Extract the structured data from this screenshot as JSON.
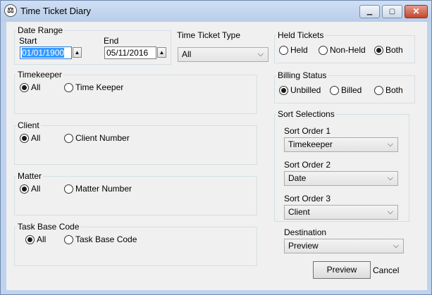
{
  "window": {
    "title": "Time Ticket Diary",
    "app_icon": "scales-icon",
    "min_icon": "minimize-icon",
    "max_icon": "maximize-icon",
    "close_icon": "close-icon"
  },
  "date_range": {
    "label": "Date Range",
    "start_label": "Start",
    "start_value": "01/01/1900",
    "end_label": "End",
    "end_value": "05/11/2016"
  },
  "time_ticket_type": {
    "label": "Time Ticket Type",
    "value": "All"
  },
  "held_tickets": {
    "label": "Held Tickets",
    "options": [
      "Held",
      "Non-Held",
      "Both"
    ],
    "selected": "Both"
  },
  "billing_status": {
    "label": "Billing Status",
    "options": [
      "Unbilled",
      "Billed",
      "Both"
    ],
    "selected": "Unbilled"
  },
  "timekeeper": {
    "label": "Timekeeper",
    "opt_all": "All",
    "opt_specific": "Time Keeper"
  },
  "client": {
    "label": "Client",
    "opt_all": "All",
    "opt_specific": "Client Number"
  },
  "matter": {
    "label": "Matter",
    "opt_all": "All",
    "opt_specific": "Matter Number"
  },
  "task_base_code": {
    "label": "Task Base Code",
    "opt_all": "All",
    "opt_specific": "Task Base Code"
  },
  "sort": {
    "label": "Sort Selections",
    "order1_label": "Sort Order 1",
    "order1_value": "Timekeeper",
    "order2_label": "Sort Order 2",
    "order2_value": "Date",
    "order3_label": "Sort Order 3",
    "order3_value": "Client"
  },
  "destination": {
    "label": "Destination",
    "value": "Preview"
  },
  "buttons": {
    "preview": "Preview",
    "cancel": "Cancel"
  }
}
